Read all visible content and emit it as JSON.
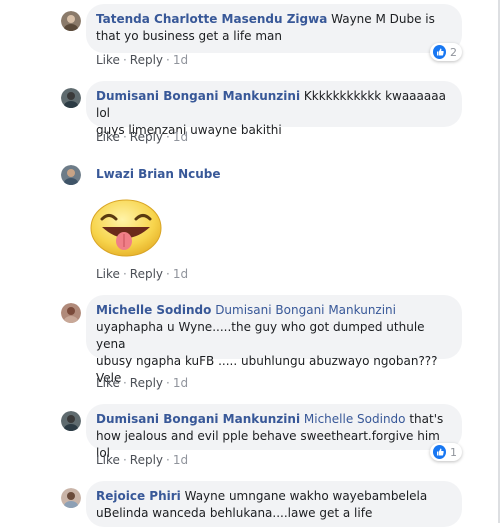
{
  "colors": {
    "link": "#385898",
    "bubble": "#f2f3f5",
    "like_blue": "#1877f2"
  },
  "comments": [
    {
      "author": "Tatenda Charlotte Masendu Zigwa",
      "mention": "",
      "text": "Wayne M Dube is that yo business get a life man",
      "text_line2": "",
      "reactions": "2"
    },
    {
      "author": "Dumisani Bongani Mankunzini",
      "mention": "",
      "text": "Kkkkkkkkkkk kwaaaaaa lol",
      "text_line2": "guys limenzani uwayne bakithi",
      "reactions": ""
    },
    {
      "author": "Lwazi Brian Ncube",
      "mention": "",
      "text": "",
      "text_line2": "",
      "reactions": "",
      "sticker": "tongue-out-emoji"
    },
    {
      "author": "Michelle Sodindo",
      "mention": "Dumisani Bongani Mankunzini",
      "text": "uyaphapha u Wyne.....the guy who got dumped uthule yena ubusy ngapha kuFB ..... ubuhlungu abuzwayo ngoban??? Vele",
      "reactions": ""
    },
    {
      "author": "Dumisani Bongani Mankunzini",
      "mention": "Michelle Sodindo",
      "text": "that's",
      "text_line2": "how jealous and evil pple behave sweetheart.forgive him lol",
      "reactions": "1"
    },
    {
      "author": "Rejoice Phiri",
      "mention": "",
      "text": "Wayne umngane wakho wayebambelela",
      "text_line2": "uBelinda wanceda behlukana....lawe get a life",
      "reactions": ""
    }
  ],
  "actions": {
    "like": "Like",
    "reply": "Reply",
    "sep": "·",
    "time": "1d"
  },
  "michelle_lines": [
    "uyaphapha u Wyne.....the guy who got dumped uthule yena",
    "ubusy ngapha kuFB ..... ubuhlungu abuzwayo ngoban???",
    "Vele"
  ]
}
